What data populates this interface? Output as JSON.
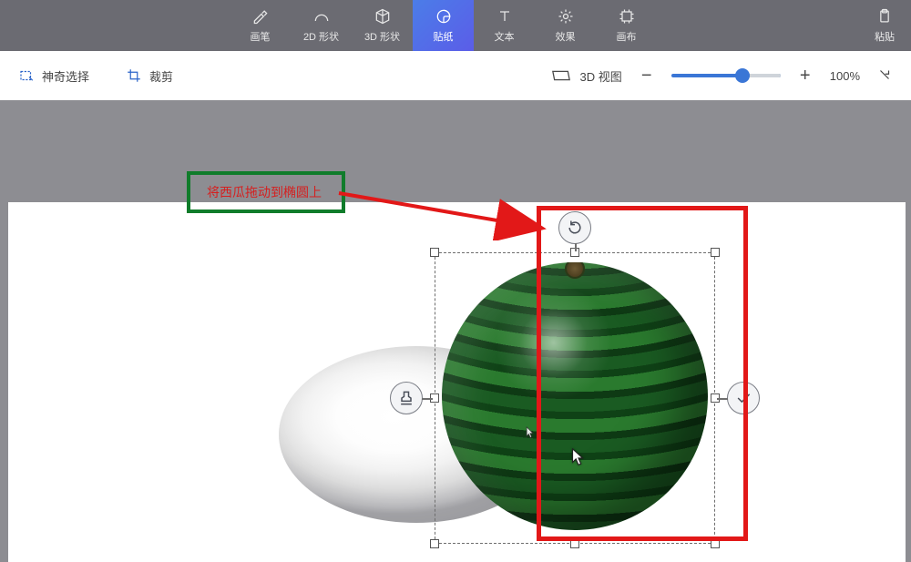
{
  "toolbar": {
    "tabs": [
      {
        "id": "brush",
        "label": "画笔"
      },
      {
        "id": "shape2d",
        "label": "2D 形状"
      },
      {
        "id": "shape3d",
        "label": "3D 形状"
      },
      {
        "id": "sticker",
        "label": "贴纸"
      },
      {
        "id": "text",
        "label": "文本"
      },
      {
        "id": "effects",
        "label": "效果"
      },
      {
        "id": "canvas",
        "label": "画布"
      }
    ],
    "paste_label": "粘贴"
  },
  "subtoolbar": {
    "magic_select": "神奇选择",
    "crop": "裁剪",
    "view3d": "3D 视图",
    "zoom_percent": "100%"
  },
  "annotations": {
    "instruction": "将西瓜拖动到椭圆上"
  },
  "selection": {
    "rotate_icon": "rotate-icon",
    "stamp_icon": "stamp-icon",
    "confirm_icon": "check-icon"
  },
  "slider": {
    "value_pct": 65
  }
}
